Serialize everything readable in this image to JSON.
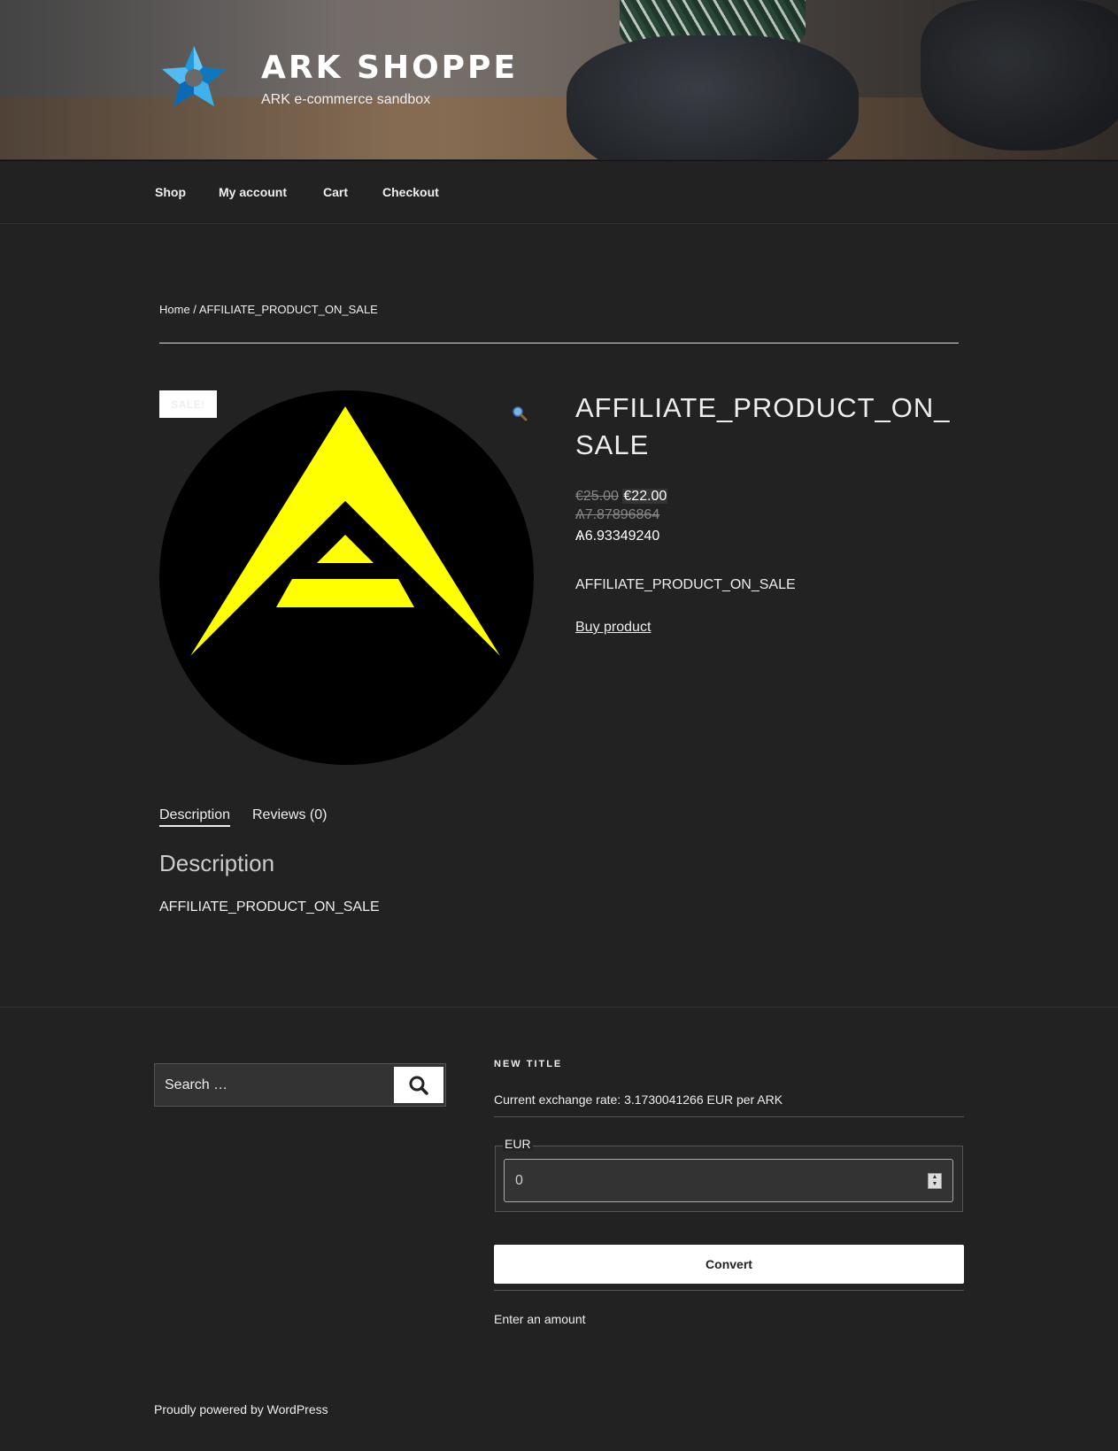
{
  "header": {
    "site_title": "ARK SHOPPE",
    "site_description": "ARK e-commerce sandbox"
  },
  "nav": {
    "items": [
      {
        "label": "Shop"
      },
      {
        "label": "My account"
      },
      {
        "label": "Cart"
      },
      {
        "label": "Checkout"
      }
    ]
  },
  "breadcrumb": {
    "home": "Home",
    "separator": " / ",
    "current": "AFFILIATE_PRODUCT_ON_SALE"
  },
  "product": {
    "sale_badge": "SALE!",
    "title": "AFFILIATE_PRODUCT_ON_SALE",
    "price_old": "€25.00",
    "price_new": "€22.00",
    "ark_price_old": "Ѧ7.87896864",
    "ark_price_new": "Ѧ6.93349240",
    "short_description": "AFFILIATE_PRODUCT_ON_SALE",
    "buy_label": "Buy product",
    "zoom_icon": "magnifier-icon"
  },
  "tabs": [
    {
      "label": "Description",
      "active": true
    },
    {
      "label": "Reviews (0)",
      "active": false
    }
  ],
  "description": {
    "heading": "Description",
    "text": "AFFILIATE_PRODUCT_ON_SALE"
  },
  "footer": {
    "search": {
      "placeholder": "Search …",
      "icon": "search-icon"
    },
    "widget": {
      "title": "NEW TITLE",
      "rate_text": "Current exchange rate: 3.1730041266 EUR per ARK",
      "currency_legend": "EUR",
      "amount_value": "0",
      "convert_label": "Convert",
      "result_text": "Enter an amount"
    },
    "powered_by": "Proudly powered by WordPress"
  },
  "colors": {
    "background": "#222222",
    "text": "#eeeeee",
    "ark_yellow": "#ffff00",
    "logo_blue": "#1e9be0"
  }
}
